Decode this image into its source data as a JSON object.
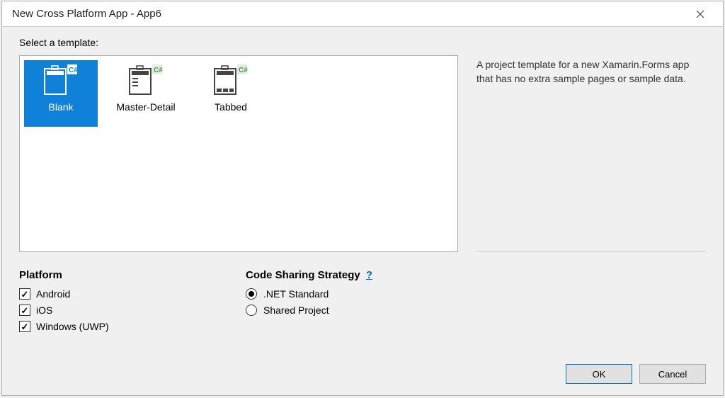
{
  "window": {
    "title": "New Cross Platform App - App6"
  },
  "selectLabel": "Select a template:",
  "templates": [
    {
      "label": "Blank",
      "selected": true
    },
    {
      "label": "Master-Detail",
      "selected": false
    },
    {
      "label": "Tabbed",
      "selected": false
    }
  ],
  "description": "A project template for a new Xamarin.Forms app that has no extra sample pages or sample data.",
  "platformSection": {
    "heading": "Platform",
    "options": [
      {
        "label": "Android",
        "checked": true
      },
      {
        "label": "iOS",
        "checked": true
      },
      {
        "label": "Windows (UWP)",
        "checked": true
      }
    ]
  },
  "codeSharingSection": {
    "heading": "Code Sharing Strategy",
    "helpSymbol": "?",
    "options": [
      {
        "label": ".NET Standard",
        "selected": true
      },
      {
        "label": "Shared Project",
        "selected": false
      }
    ]
  },
  "buttons": {
    "ok": "OK",
    "cancel": "Cancel"
  }
}
